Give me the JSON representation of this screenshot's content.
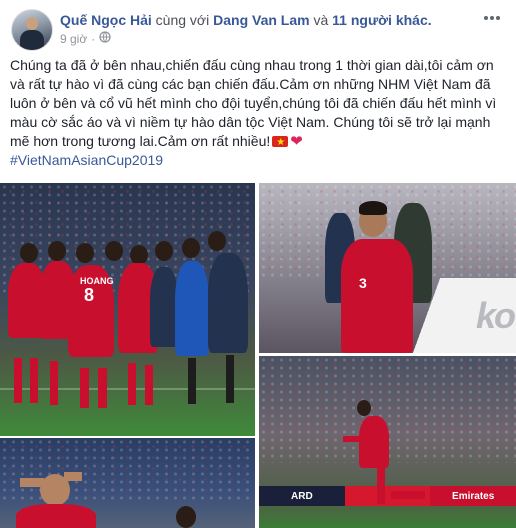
{
  "header": {
    "author": "Quế Ngọc Hải",
    "with_text": " cùng với ",
    "tagged_user": "Dang Van Lam",
    "and_text": " và ",
    "others": "11 người khác.",
    "time": "9 giờ",
    "separator": "·",
    "privacy_icon": "globe-icon",
    "more_icon": "more-options-icon"
  },
  "post": {
    "text": "Chúng ta đã ở bên nhau,chiến đấu cùng nhau trong 1 thời gian dài,tôi cảm ơn và rất tự hào vì đã cùng các bạn chiến đấu.Cảm ơn những NHM Việt Nam đã luôn ở bên và cổ vũ hết mình cho đội tuyển,chúng tôi đã chiến đấu hết mình vì màu cờ sắc áo và vì niềm tự hào dân tộc Việt Nam. Chúng tôi sẽ trở lại mạnh mẽ hơn trong tương lai.Cảm ơn rất nhiều!",
    "emoji_flag": "vietnam-flag-icon",
    "emoji_heart": "❤",
    "hashtag": "#VietNamAsianCup2019"
  },
  "photos": {
    "p1_jersey_name": "HOANG",
    "p1_jersey_number": "8",
    "p2_jersey_number": "3",
    "p2_ad_text": "ko",
    "p3_ads": [
      "ARD",
      "",
      "Emirates"
    ]
  },
  "colors": {
    "link": "#385898",
    "jersey_red": "#c8102e",
    "meta_gray": "#90949c"
  }
}
